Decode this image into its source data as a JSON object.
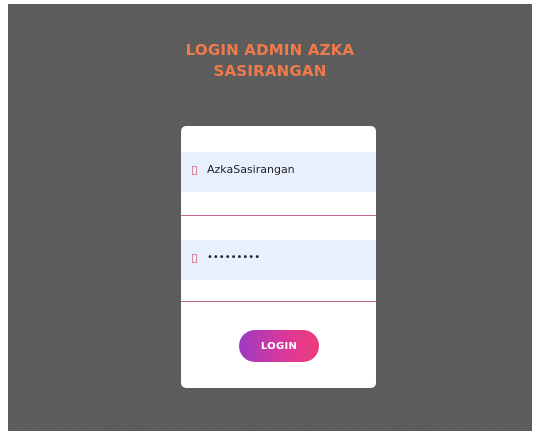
{
  "page": {
    "title_line1": "LOGIN ADMIN AZKA",
    "title_line2": "SASIRANGAN"
  },
  "form": {
    "username": {
      "value": "AzkaSasirangan",
      "icon": "user-icon"
    },
    "password": {
      "value": "•••••••••",
      "icon": "lock-icon"
    },
    "login_label": "LOGIN"
  },
  "colors": {
    "background": "#5c5c5c",
    "title": "#f07a4a",
    "field_fill": "#e8f0fe",
    "field_underline": "#c56a9a",
    "button_gradient_start": "#9b3bc4",
    "button_gradient_end": "#ef3d7b"
  }
}
